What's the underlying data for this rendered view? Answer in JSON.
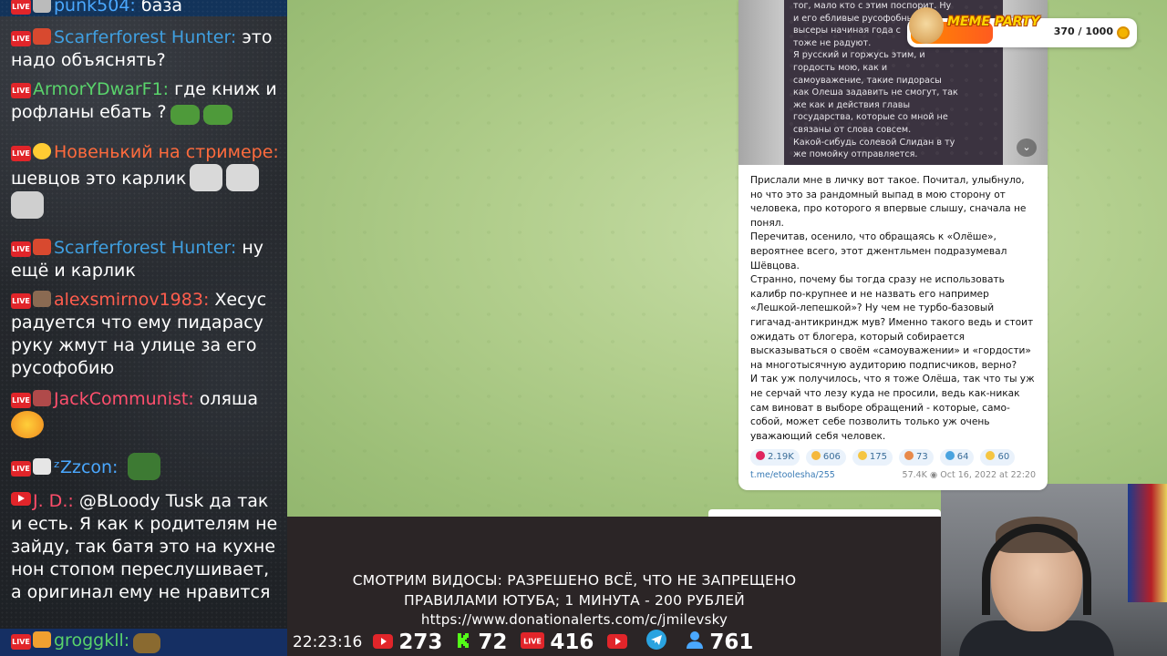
{
  "chat": {
    "messages": [
      {
        "nick": "punk504:",
        "text": "база",
        "nick_color": "#4aa8ff"
      },
      {
        "nick": "Scarferforest Hunter:",
        "text": "это надо объяснять?",
        "nick_color": "#3f9fe0"
      },
      {
        "nick": "ArmorYDwarF1:",
        "text": "где книж и рофланы ебать ?",
        "nick_color": "#59d36b"
      },
      {
        "nick": "Новенький на стримере:",
        "text": "шевцов это карлик",
        "nick_color": "#ff6b3d"
      },
      {
        "nick": "Scarferforest Hunter:",
        "text": "ну ещё и карлик",
        "nick_color": "#3f9fe0"
      },
      {
        "nick": "alexsmirnov1983:",
        "text": "Хесус радуется что ему пидарасу руку жмут на улице за его русофобию",
        "nick_color": "#ff5d4d"
      },
      {
        "nick": "JackCommunist:",
        "text": "оляша",
        "nick_color": "#ff4f6d"
      },
      {
        "nick": "ᶻZzcon:",
        "text": "",
        "nick_color": "#4aa8ff"
      },
      {
        "nick": "J. D.:",
        "text": "@BLoody Tusk да так и есть. Я как к родителям не зайду, так батя это на кухне нон стопом переслушивает, а оригинал ему не нравится",
        "nick_color": "#ff4d6a"
      },
      {
        "nick": "groggkll:",
        "text": "",
        "nick_color": "#59d36b"
      }
    ],
    "badge_live": "LIVE"
  },
  "telegram": {
    "image_text": "тог, мало кто с этим поспорит. Ну\nи его ебливые русофобные\nвысеры начиная года с\nтоже не радуют.\nЯ русский и горжусь этим, и\nгордость мою, как и\nсамоуважение, такие пидорасы\nкак Олеша задавить не смогут, так\nже как и действия главы\nгосударства, которые со мной не\nсвязаны от слова совсем.\nКакой-сибудь солевой Слидан в ту\nже помойку отправляется.",
    "post_text": "Прислали мне в личку вот такое. Почитал, улыбнуло,\nно что это за рандомный выпад в мою сторону от\nчеловека, про которого я впервые слышу, сначала не\nпонял.\nПеречитав, осенило, что обращаясь к «Олёше»,\nвероятнее всего, этот джентльмен подразумевал\nШёвцова.\nСтранно, почему бы тогда сразу не использовать\nкалибр по-крупнее и не назвать его например\n«Лешкой-лепешкой»? Ну чем не турбо-базовый\nгигачад-антикриндж мув? Именно такого ведь и стоит\nожидать от блогера, который собирается\nвысказываться о своём «самоуважении» и «гордости»\nна многотысячную аудиторию подписчиков, верно?\nИ так уж получилось, что я тоже Олёша, так что ты уж\nне серчай что лезу куда не просили, ведь как-никак\nсам виноват в выборе обращений - которые, само-\nсобой, может себе позволить только уж очень\nуважающий себя человек.",
    "reactions": [
      {
        "emoji": "heart",
        "count": "2.19K",
        "color": "#e0245e"
      },
      {
        "emoji": "laugh",
        "count": "606",
        "color": "#f5b83d"
      },
      {
        "emoji": "grin",
        "count": "175",
        "color": "#f5c542"
      },
      {
        "emoji": "hotdog",
        "count": "73",
        "color": "#e8894a"
      },
      {
        "emoji": "whale",
        "count": "64",
        "color": "#4aa3df"
      },
      {
        "emoji": "thumbsup",
        "count": "60",
        "color": "#f5c542"
      }
    ],
    "link": "t.me/etoolesha/255",
    "views": "57.4K",
    "date": "Oct 16, 2022 at 22:20"
  },
  "meme_party": {
    "title": "MEME PARTY",
    "progress_text": "370 / 1000",
    "progress": 0.37
  },
  "announcement": {
    "line1": "СМОТРИМ ВИДОСЫ: РАЗРЕШЕНО ВСЁ, ЧТО НЕ ЗАПРЕЩЕНО",
    "line2": "ПРАВИЛАМИ ЮТУБА; 1 МИНУТА - 200 РУБЛЕЙ",
    "line3": "https://www.donationalerts.com/c/jmilevsky"
  },
  "status": {
    "time": "22:23:16",
    "youtube": "273",
    "kick": "72",
    "live": "416",
    "viewers": "761"
  }
}
